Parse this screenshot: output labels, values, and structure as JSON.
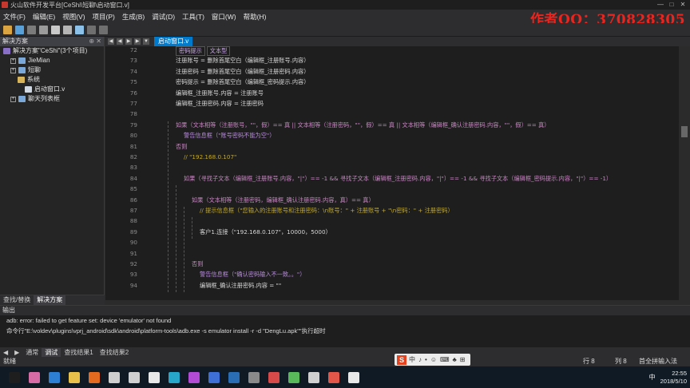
{
  "window": {
    "title": "火山软件开发平台[CeShi\\短聊\\启动窗口.v]",
    "controls": [
      "—",
      "□",
      "✕"
    ]
  },
  "menu": [
    "文件(F)",
    "编辑(E)",
    "视图(V)",
    "项目(P)",
    "生成(B)",
    "调试(D)",
    "工具(T)",
    "窗口(W)",
    "帮助(H)"
  ],
  "author": "作者QQ：370828305",
  "solution_panel": {
    "title": "解决方案",
    "pin": "⊕ ✕",
    "tree": [
      {
        "label": "解决方案\"CeShi\"(3个项目)",
        "indent": 0,
        "icon": "solution-icon"
      },
      {
        "label": "JieMian",
        "indent": 1,
        "icon": "project-icon"
      },
      {
        "label": "短聊",
        "indent": 1,
        "icon": "project-icon"
      },
      {
        "label": "系统",
        "indent": 2,
        "icon": "folder-icon"
      },
      {
        "label": "启动窗口.v",
        "indent": 3,
        "icon": "file-icon"
      },
      {
        "label": "聊天列表框",
        "indent": 1,
        "icon": "project-icon"
      }
    ],
    "tabs": [
      "查找/替换",
      "解决方案"
    ]
  },
  "editor": {
    "tab": "启动窗口.v",
    "header_cells": [
      "密码提示",
      "文本型"
    ],
    "lines": [
      {
        "n": "72",
        "indent": 0,
        "text": "",
        "cls": "c-def",
        "header": true
      },
      {
        "n": "73",
        "indent": 0,
        "text": "注册账号 = 删除首尾空白（编辑框_注册账号.内容）",
        "cls": "c-def"
      },
      {
        "n": "74",
        "indent": 0,
        "text": "注册密码 = 删除首尾空白（编辑框_注册密码.内容）",
        "cls": "c-def"
      },
      {
        "n": "75",
        "indent": 0,
        "text": "密码提示 = 删除首尾空白（编辑框_密码提示.内容）",
        "cls": "c-def"
      },
      {
        "n": "76",
        "indent": 0,
        "text": "编辑框_注册账号.内容 = 注册账号",
        "cls": "c-def"
      },
      {
        "n": "77",
        "indent": 0,
        "text": "编辑框_注册密码.内容 = 注册密码",
        "cls": "c-def"
      },
      {
        "n": "78",
        "indent": 0,
        "text": "",
        "cls": "c-def"
      },
      {
        "n": "79",
        "indent": 0,
        "text": "如果（文本相等（注册账号，\"\"，假）== 真 || 文本相等（注册密码，\"\"，假）== 真 || 文本相等（编辑框_确认注册密码.内容，\"\"，假）== 真）",
        "cls": "c-kw"
      },
      {
        "n": "80",
        "indent": 1,
        "text": "警告信息框（\"账号密码不能为空\"）",
        "cls": "c-fn"
      },
      {
        "n": "81",
        "indent": 0,
        "text": "否则",
        "cls": "c-kw"
      },
      {
        "n": "82",
        "indent": 1,
        "text": "// \"192.168.0.107\"",
        "cls": "c-comment"
      },
      {
        "n": "83",
        "indent": 0,
        "text": "",
        "cls": "c-def"
      },
      {
        "n": "84",
        "indent": 1,
        "text": "如果（寻找子文本（编辑框_注册账号.内容，\"|\"）== -1 && 寻找子文本（编辑框_注册密码.内容，\"|\"）== -1 && 寻找子文本（编辑框_密码提示.内容，\"|\"）== -1）",
        "cls": "c-kw"
      },
      {
        "n": "85",
        "indent": 0,
        "text": "",
        "cls": "c-def"
      },
      {
        "n": "86",
        "indent": 2,
        "text": "如果（文本相等（注册密码，编辑框_确认注册密码.内容，真）== 真）",
        "cls": "c-kw"
      },
      {
        "n": "87",
        "indent": 3,
        "text": "// 提示信息框（\"您输入的注册账号和注册密码：\\n账号：\" + 注册账号 + \"\\n密码：\" + 注册密码）",
        "cls": "c-comment"
      },
      {
        "n": "88",
        "indent": 0,
        "text": "",
        "cls": "c-def"
      },
      {
        "n": "89",
        "indent": 3,
        "text": "客户1.连接（\"192.168.0.107\"，10000，5000）",
        "cls": "c-def"
      },
      {
        "n": "90",
        "indent": 0,
        "text": "",
        "cls": "c-def"
      },
      {
        "n": "91",
        "indent": 0,
        "text": "",
        "cls": "c-def"
      },
      {
        "n": "92",
        "indent": 2,
        "text": "否则",
        "cls": "c-kw"
      },
      {
        "n": "93",
        "indent": 3,
        "text": "警告信息框（\"确认密码输入不一致。。\"）",
        "cls": "c-fn"
      },
      {
        "n": "94",
        "indent": 3,
        "text": "编辑框_确认注册密码.内容 = \"\"",
        "cls": "c-def"
      }
    ]
  },
  "output": {
    "title": "输出",
    "lines": [
      "adb: error: failed to get feature set: device 'emulator' not found",
      "命令行\"E:\\voldev\\plugins\\vprj_android\\sdk\\android\\platform-tools\\adb.exe -s emulator install -r -d \"DengLu.apk\"\"执行超时"
    ]
  },
  "bottom_tabs": [
    "通常",
    "调试",
    "查找结果1",
    "查找结果2"
  ],
  "status": {
    "left": "就绪",
    "row": "行 8",
    "col": "列 8",
    "char": "字符 8",
    "mode": "首全拼输入法"
  },
  "ime": {
    "logo": "S",
    "items": [
      "中",
      "♪",
      "•",
      "☺",
      "⌨",
      "♣",
      "⊞"
    ]
  },
  "tray": {
    "lang": "中",
    "time": "22:55",
    "date": "2018/5/10"
  },
  "taskbar_icons": [
    {
      "name": "start-button",
      "color": "#1e1e1e"
    },
    {
      "name": "apps-icon",
      "color": "#d86aa6"
    },
    {
      "name": "edge-icon",
      "color": "#2d7fd3"
    },
    {
      "name": "explorer-icon",
      "color": "#e8c04a"
    },
    {
      "name": "firefox-icon",
      "color": "#e36a1e"
    },
    {
      "name": "window-icon",
      "color": "#cfcfcf"
    },
    {
      "name": "calculator-icon",
      "color": "#d0d0d0"
    },
    {
      "name": "calculator-icon-2",
      "color": "#e8e8e8"
    },
    {
      "name": "qq-icon",
      "color": "#27a6c9"
    },
    {
      "name": "wave-icon",
      "color": "#b44bd4"
    },
    {
      "name": "notepad-icon",
      "color": "#3d6fd6"
    },
    {
      "name": "terminal-icon",
      "color": "#2a6db5"
    },
    {
      "name": "cmd-icon",
      "color": "#8a8a8a"
    },
    {
      "name": "volcano-icon",
      "color": "#d64a4a"
    },
    {
      "name": "chat-icon",
      "color": "#58b85a"
    },
    {
      "name": "capture-icon",
      "color": "#d0d0d0"
    },
    {
      "name": "volcano-icon-2",
      "color": "#e2564a"
    },
    {
      "name": "app-icon",
      "color": "#e8e8e8"
    }
  ]
}
